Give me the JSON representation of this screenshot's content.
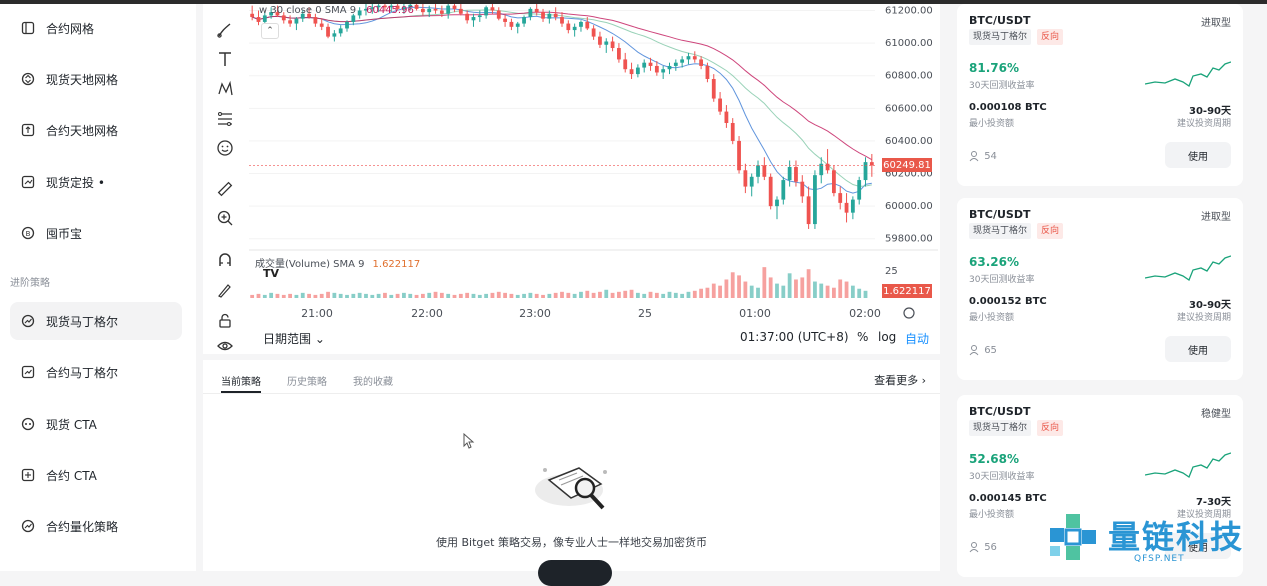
{
  "sidebar": {
    "items": [
      {
        "label": "合约网格",
        "icon": "contract-grid-icon"
      },
      {
        "label": "现货天地网格",
        "icon": "spot-infinity-grid-icon"
      },
      {
        "label": "合约天地网格",
        "icon": "contract-infinity-grid-icon"
      },
      {
        "label": "现货定投 •",
        "icon": "spot-dca-icon"
      },
      {
        "label": "囤币宝",
        "icon": "coin-hoard-icon"
      },
      {
        "label": "现货马丁格尔",
        "icon": "spot-martingale-icon"
      },
      {
        "label": "合约马丁格尔",
        "icon": "contract-martingale-icon"
      },
      {
        "label": "现货 CTA",
        "icon": "spot-cta-icon"
      },
      {
        "label": "合约 CTA",
        "icon": "contract-cta-icon"
      },
      {
        "label": "合约量化策略",
        "icon": "contract-quant-icon"
      }
    ],
    "section_label": "进阶策略",
    "active_item": "现货马丁格尔"
  },
  "chart": {
    "legend_prefix": "w 30 close 0 SMA 9",
    "legend_value": "60445.96",
    "volume_label": "成交量(Volume) SMA 9",
    "volume_value": "1.622117",
    "volume_axis_label": "25",
    "current_price": "60249.81",
    "current_volume": "1.622117",
    "range_label": "日期范围",
    "time_display": "01:37:00 (UTC+8)",
    "pct_label": "%",
    "log_label": "log",
    "auto_label": "自动",
    "tv_logo": "TV"
  },
  "chart_data": {
    "type": "candlestick",
    "y_ticks": [
      "61200.00",
      "61000.00",
      "60800.00",
      "60600.00",
      "60400.00",
      "60200.00",
      "60000.00",
      "59800.00"
    ],
    "ylim": [
      59780,
      61240
    ],
    "x_ticks": [
      "21:00",
      "22:00",
      "23:00",
      "25",
      "01:00",
      "02:00"
    ],
    "candles": [
      [
        61180,
        61230,
        61140,
        61160
      ],
      [
        61160,
        61200,
        61110,
        61130
      ],
      [
        61130,
        61190,
        61100,
        61170
      ],
      [
        61170,
        61220,
        61150,
        61190
      ],
      [
        61190,
        61230,
        61160,
        61170
      ],
      [
        61170,
        61190,
        61120,
        61140
      ],
      [
        61140,
        61170,
        61100,
        61120
      ],
      [
        61120,
        61160,
        61080,
        61150
      ],
      [
        61150,
        61200,
        61130,
        61180
      ],
      [
        61180,
        61220,
        61150,
        61160
      ],
      [
        61160,
        61180,
        61100,
        61120
      ],
      [
        61120,
        61150,
        61080,
        61100
      ],
      [
        61100,
        61120,
        61030,
        61040
      ],
      [
        61040,
        61080,
        61010,
        61060
      ],
      [
        61060,
        61110,
        61040,
        61090
      ],
      [
        61090,
        61140,
        61070,
        61130
      ],
      [
        61130,
        61180,
        61110,
        61170
      ],
      [
        61170,
        61220,
        61150,
        61200
      ],
      [
        61200,
        61240,
        61170,
        61210
      ],
      [
        61210,
        61240,
        61180,
        61220
      ],
      [
        61220,
        61240,
        61190,
        61230
      ],
      [
        61230,
        61240,
        61200,
        61220
      ],
      [
        61220,
        61240,
        61190,
        61230
      ],
      [
        61230,
        61240,
        61200,
        61210
      ],
      [
        61210,
        61240,
        61180,
        61220
      ],
      [
        61220,
        61240,
        61200,
        61235
      ],
      [
        61235,
        61240,
        61200,
        61210
      ],
      [
        61210,
        61240,
        61170,
        61190
      ],
      [
        61190,
        61230,
        61160,
        61210
      ],
      [
        61210,
        61240,
        61180,
        61200
      ],
      [
        61200,
        61230,
        61160,
        61180
      ],
      [
        61180,
        61240,
        61150,
        61230
      ],
      [
        61230,
        61240,
        61190,
        61210
      ],
      [
        61210,
        61240,
        61170,
        61180
      ],
      [
        61180,
        61200,
        61120,
        61140
      ],
      [
        61140,
        61180,
        61100,
        61160
      ],
      [
        61160,
        61200,
        61130,
        61170
      ],
      [
        61170,
        61230,
        61150,
        61220
      ],
      [
        61220,
        61240,
        61180,
        61200
      ],
      [
        61200,
        61220,
        61140,
        61150
      ],
      [
        61150,
        61180,
        61100,
        61130
      ],
      [
        61130,
        61150,
        61080,
        61100
      ],
      [
        61100,
        61130,
        61060,
        61120
      ],
      [
        61120,
        61170,
        61100,
        61160
      ],
      [
        61160,
        61220,
        61140,
        61210
      ],
      [
        61210,
        61240,
        61170,
        61190
      ],
      [
        61190,
        61210,
        61130,
        61150
      ],
      [
        61150,
        61200,
        61120,
        61180
      ],
      [
        61180,
        61220,
        61140,
        61160
      ],
      [
        61160,
        61190,
        61100,
        61120
      ],
      [
        61120,
        61140,
        61060,
        61080
      ],
      [
        61080,
        61120,
        61040,
        61100
      ],
      [
        61100,
        61140,
        61070,
        61130
      ],
      [
        61130,
        61160,
        61080,
        61090
      ],
      [
        61090,
        61110,
        61020,
        61040
      ],
      [
        61040,
        61070,
        60970,
        60990
      ],
      [
        60990,
        61030,
        60940,
        61010
      ],
      [
        61010,
        61040,
        60950,
        60970
      ],
      [
        60970,
        61000,
        60880,
        60900
      ],
      [
        60900,
        60940,
        60820,
        60840
      ],
      [
        60840,
        60880,
        60780,
        60810
      ],
      [
        60810,
        60870,
        60790,
        60850
      ],
      [
        60850,
        60900,
        60820,
        60880
      ],
      [
        60880,
        60910,
        60830,
        60860
      ],
      [
        60860,
        60890,
        60800,
        60820
      ],
      [
        60820,
        60860,
        60780,
        60840
      ],
      [
        60840,
        60880,
        60810,
        60860
      ],
      [
        60860,
        60900,
        60830,
        60880
      ],
      [
        60880,
        60920,
        60850,
        60900
      ],
      [
        60900,
        60940,
        60870,
        60920
      ],
      [
        60920,
        60950,
        60880,
        60900
      ],
      [
        60900,
        60920,
        60840,
        60860
      ],
      [
        60860,
        60880,
        60760,
        60780
      ],
      [
        60780,
        60810,
        60640,
        60660
      ],
      [
        60660,
        60700,
        60560,
        60580
      ],
      [
        60580,
        60620,
        60480,
        60510
      ],
      [
        60510,
        60540,
        60380,
        60400
      ],
      [
        60400,
        60430,
        60200,
        60220
      ],
      [
        60220,
        60260,
        60080,
        60120
      ],
      [
        60120,
        60200,
        60060,
        60180
      ],
      [
        60180,
        60280,
        60140,
        60250
      ],
      [
        60250,
        60300,
        60160,
        60180
      ],
      [
        60180,
        60200,
        59980,
        60000
      ],
      [
        60000,
        60060,
        59920,
        60040
      ],
      [
        60040,
        60180,
        60010,
        60160
      ],
      [
        60160,
        60280,
        60120,
        60240
      ],
      [
        60240,
        60280,
        60120,
        60150
      ],
      [
        60150,
        60190,
        60020,
        60060
      ],
      [
        60060,
        60120,
        59860,
        59890
      ],
      [
        59890,
        60220,
        59860,
        60190
      ],
      [
        60190,
        60300,
        60140,
        60260
      ],
      [
        60260,
        60350,
        60200,
        60220
      ],
      [
        60220,
        60250,
        60060,
        60080
      ],
      [
        60080,
        60120,
        59980,
        60020
      ],
      [
        60020,
        60080,
        59900,
        59960
      ],
      [
        59960,
        60060,
        59920,
        60040
      ],
      [
        60040,
        60180,
        60010,
        60160
      ],
      [
        60160,
        60300,
        60120,
        60270
      ],
      [
        60270,
        60320,
        60180,
        60249.81
      ]
    ],
    "volumes": [
      3,
      4,
      3,
      5,
      4,
      3,
      4,
      3,
      5,
      4,
      3,
      4,
      6,
      5,
      4,
      3,
      4,
      5,
      4,
      3,
      4,
      5,
      3,
      4,
      5,
      4,
      3,
      4,
      5,
      6,
      5,
      4,
      3,
      4,
      5,
      4,
      3,
      4,
      5,
      6,
      5,
      4,
      3,
      4,
      5,
      4,
      3,
      4,
      5,
      6,
      5,
      4,
      6,
      7,
      5,
      6,
      8,
      5,
      6,
      7,
      8,
      5,
      4,
      6,
      5,
      4,
      6,
      5,
      4,
      6,
      7,
      9,
      10,
      14,
      12,
      18,
      25,
      22,
      16,
      12,
      10,
      30,
      20,
      14,
      12,
      24,
      18,
      20,
      28,
      16,
      14,
      12,
      10,
      18,
      16,
      12,
      9,
      7
    ],
    "volume_ylim": [
      0,
      35
    ]
  },
  "bottom": {
    "tabs": [
      "当前策略",
      "历史策略",
      "我的收藏"
    ],
    "see_more": "查看更多 ›",
    "empty_text": "使用 Bitget 策略交易，像专业人士一样地交易加密货币"
  },
  "cards": [
    {
      "pair": "BTC/USDT",
      "type": "进取型",
      "tag1": "现货马丁格尔",
      "tag2": "反向",
      "ret": "81.76%",
      "ret_label": "30天回测收益率",
      "min": "0.000108 BTC",
      "min_label": "最小投资额",
      "period": "30-90天",
      "period_label": "建议投资周期",
      "users": "54",
      "button": "使用"
    },
    {
      "pair": "BTC/USDT",
      "type": "进取型",
      "tag1": "现货马丁格尔",
      "tag2": "反向",
      "ret": "63.26%",
      "ret_label": "30天回测收益率",
      "min": "0.000152 BTC",
      "min_label": "最小投资额",
      "period": "30-90天",
      "period_label": "建议投资周期",
      "users": "65",
      "button": "使用"
    },
    {
      "pair": "BTC/USDT",
      "type": "稳健型",
      "tag1": "现货马丁格尔",
      "tag2": "反向",
      "ret": "52.68%",
      "ret_label": "30天回测收益率",
      "min": "0.000145 BTC",
      "min_label": "最小投资额",
      "period": "7-30天",
      "period_label": "建议投资周期",
      "users": "56",
      "button": "使用"
    }
  ],
  "colors": {
    "up": "#26a69a",
    "down": "#ef5350",
    "accent": "#1890ff",
    "positive": "#1aa37a",
    "price_tag": "#e9584a"
  },
  "watermark": {
    "text": "量链科技",
    "sub": "QFSP.NET"
  }
}
